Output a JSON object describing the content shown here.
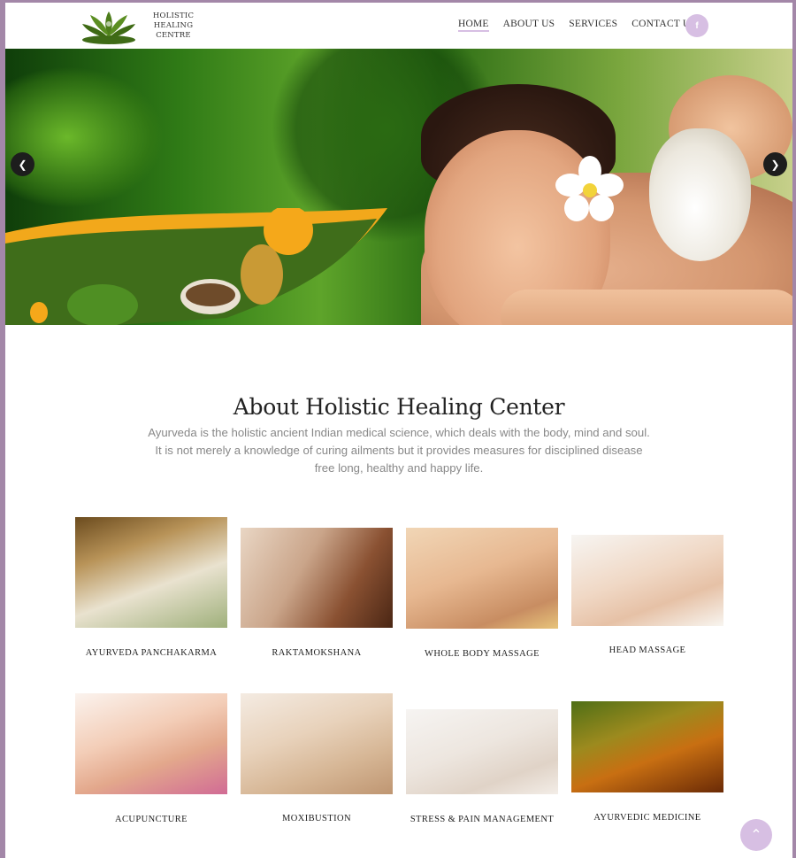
{
  "brand": {
    "name_line1": "HOLISTIC HEALING",
    "name_line2": "CENTRE",
    "logo_icon": "lotus-icon"
  },
  "nav": {
    "items": [
      {
        "label": "HOME",
        "active": true
      },
      {
        "label": "ABOUT US",
        "active": false
      },
      {
        "label": "SERVICES",
        "active": false
      },
      {
        "label": "CONTACT US",
        "active": false
      }
    ],
    "social_label": "f"
  },
  "hero": {
    "prev_arrow": "❮",
    "next_arrow": "❯"
  },
  "about": {
    "title": "About Holistic Healing Center",
    "text": "Ayurveda is the holistic ancient Indian medical science, which deals with the body, mind and soul. It is not merely a knowledge of curing ailments but it provides measures for disciplined disease free long, healthy and happy life."
  },
  "services": [
    {
      "label": "AYURVEDA PANCHAKARMA"
    },
    {
      "label": "RAKTAMOKSHANA"
    },
    {
      "label": "WHOLE BODY MASSAGE"
    },
    {
      "label": "HEAD MASSAGE"
    },
    {
      "label": "ACUPUNCTURE"
    },
    {
      "label": "MOXIBUSTION"
    },
    {
      "label": "STRESS & PAIN MANAGEMENT"
    },
    {
      "label": "AYURVEDIC MEDICINE"
    }
  ],
  "scroll_top": "⌃",
  "colors": {
    "accent": "#d7bfe3",
    "frame": "#a387a8",
    "text_muted": "#888888"
  }
}
